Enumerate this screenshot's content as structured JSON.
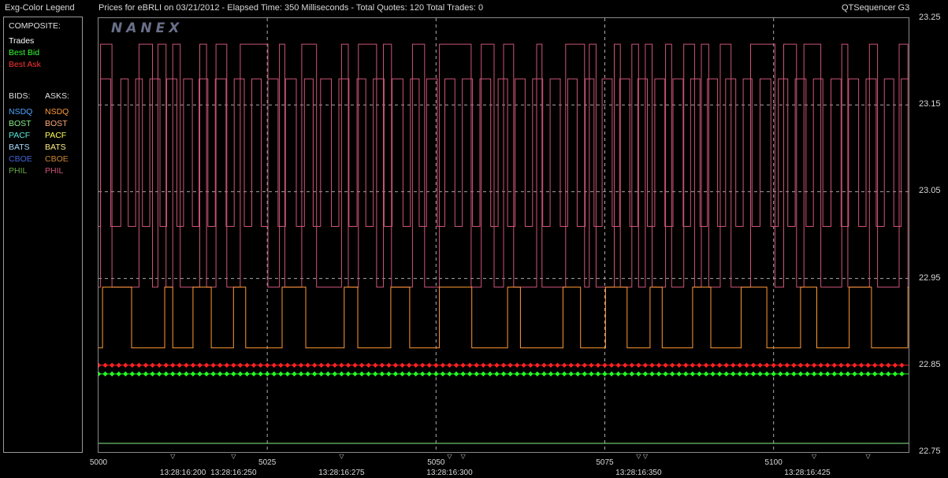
{
  "header": {
    "legend_title": "Exg-Color Legend",
    "prices_for": "Prices for  eBRLI  on  03/21/2012  -  Elapsed Time: 350 Milliseconds  -  Total Quotes: 120  Total Trades: 0",
    "app_name": "QTSequencer G3"
  },
  "legend": {
    "composite_label": "COMPOSITE:",
    "composite": [
      {
        "label": "Trades",
        "color": "#ffffff"
      },
      {
        "label": "Best Bid",
        "color": "#33ff33"
      },
      {
        "label": "Best Ask",
        "color": "#ff3333"
      }
    ],
    "bids_label": "BIDS:",
    "asks_label": "ASKS:",
    "bids": [
      {
        "label": "NSDQ",
        "color": "#4da6ff"
      },
      {
        "label": "BOST",
        "color": "#88ee88"
      },
      {
        "label": "PACF",
        "color": "#55eedd"
      },
      {
        "label": "BATS",
        "color": "#aaddff"
      },
      {
        "label": "CBOE",
        "color": "#4466dd"
      },
      {
        "label": "PHIL",
        "color": "#66aa44"
      }
    ],
    "asks": [
      {
        "label": "NSDQ",
        "color": "#ff9933"
      },
      {
        "label": "BOST",
        "color": "#ffaa77"
      },
      {
        "label": "PACF",
        "color": "#ffff55"
      },
      {
        "label": "BATS",
        "color": "#ffee88"
      },
      {
        "label": "CBOE",
        "color": "#cc8833"
      },
      {
        "label": "PHIL",
        "color": "#cc5577"
      }
    ]
  },
  "logo": "NANEX",
  "chart_data": {
    "type": "line",
    "title": "Prices for  eBRLI  on  03/21/2012",
    "ylim": [
      22.75,
      23.25
    ],
    "xlim": [
      5000,
      5120
    ],
    "y_ticks": [
      "23.25",
      "23.15",
      "23.05",
      "22.95",
      "22.85",
      "22.75"
    ],
    "y_gridlines": [
      23.15,
      23.05,
      22.95
    ],
    "x_ticks": [
      {
        "value": 5000,
        "label": "5000"
      },
      {
        "value": 5025,
        "label": "5025"
      },
      {
        "value": 5050,
        "label": "5050"
      },
      {
        "value": 5075,
        "label": "5075"
      },
      {
        "value": 5100,
        "label": "5100"
      }
    ],
    "time_labels": [
      {
        "value": 5012.5,
        "label": "13:28:16:200"
      },
      {
        "value": 5020,
        "label": "13:28:16:250"
      },
      {
        "value": 5036,
        "label": "13:28:16:275"
      },
      {
        "value": 5052,
        "label": "13:28:16:300"
      },
      {
        "value": 5080,
        "label": "13:28:16:350"
      },
      {
        "value": 5105,
        "label": "13:28:16:425"
      }
    ],
    "trade_markers": [
      5011,
      5020,
      5036,
      5052,
      5054,
      5080,
      5081,
      5106,
      5114
    ],
    "x_gridlines": [
      5025,
      5050,
      5075,
      5100
    ],
    "series": [
      {
        "name": "PHIL",
        "color": "#cc5577",
        "high": 23.22,
        "low": 22.94,
        "x": [
          5000,
          5000.3,
          5002,
          5006,
          5008,
          5008.8,
          5010,
          5011,
          5012.1,
          5015,
          5016,
          5017.4,
          5019,
          5021,
          5025.1,
          5026.8,
          5027.6,
          5030.1,
          5032.3,
          5036,
          5037,
          5038.5,
          5041.2,
          5042.2,
          5043.4,
          5046.5,
          5048.3,
          5050.5,
          5055.2,
          5056.7,
          5058.6,
          5060,
          5061.5,
          5064.9,
          5065.7,
          5069.2,
          5072,
          5072.7,
          5073.7,
          5076.4,
          5077.3,
          5079,
          5080,
          5081,
          5082,
          5084,
          5084.9,
          5086.7,
          5088.3,
          5089.3,
          5090.4,
          5092.1,
          5093.7,
          5096.6,
          5100.2,
          5101.5,
          5103.4,
          5104.5,
          5107,
          5110.1,
          5111,
          5114.2,
          5115.4,
          5118.6,
          5119.9
        ],
        "y": [
          22.94,
          23.22,
          22.94,
          23.22,
          22.94,
          23.22,
          22.94,
          23.22,
          22.94,
          23.22,
          22.94,
          23.22,
          22.94,
          23.22,
          22.94,
          23.22,
          22.94,
          23.22,
          22.94,
          23.22,
          22.94,
          23.22,
          22.94,
          23.22,
          22.94,
          23.22,
          22.94,
          23.22,
          22.94,
          23.22,
          22.94,
          23.22,
          22.94,
          23.22,
          22.94,
          23.22,
          22.94,
          23.22,
          22.94,
          23.22,
          22.94,
          23.22,
          22.94,
          23.22,
          22.94,
          23.22,
          22.94,
          23.22,
          22.94,
          23.22,
          22.94,
          23.22,
          22.94,
          23.22,
          22.94,
          23.22,
          22.94,
          23.22,
          22.94,
          23.22,
          22.94,
          23.22,
          22.94,
          23.22,
          22.94
        ]
      },
      {
        "name": "PHIL",
        "color": "#cc5577",
        "high": 23.18,
        "low": 23.01,
        "x": [
          5000,
          5000.3,
          5001.8,
          5003.3,
          5004.4,
          5005.5,
          5006.5,
          5007.6,
          5009.1,
          5010.1,
          5011.6,
          5012.6,
          5013.9,
          5014.9,
          5016.2,
          5017.3,
          5018.9,
          5020.1,
          5021.6,
          5022.7,
          5024.1,
          5025.1,
          5026.6,
          5027.7,
          5029.3,
          5030.5,
          5031.8,
          5032.9,
          5034.5,
          5035.6,
          5037.1,
          5038.3,
          5039.6,
          5040.7,
          5042.3,
          5043.5,
          5045.1,
          5046.2,
          5047.5,
          5048.6,
          5050.2,
          5051.3,
          5052.8,
          5053.9,
          5055.4,
          5056.5,
          5058.1,
          5059.2,
          5060.6,
          5061.7,
          5063.2,
          5064.3,
          5065.8,
          5066.9,
          5068.4,
          5069.5,
          5070.9,
          5072.1,
          5073.4,
          5074.6,
          5076.1,
          5077.2,
          5078.7,
          5079.9,
          5081.3,
          5082.4,
          5083.9,
          5085.1,
          5086.6,
          5087.7,
          5089.1,
          5090.2,
          5091.7,
          5092.9,
          5094.4,
          5095.5,
          5096.8,
          5098,
          5099.6,
          5100.7,
          5102.1,
          5103.2,
          5104.8,
          5105.9,
          5107.3,
          5108.5,
          5110,
          5111.1,
          5112.6,
          5113.7,
          5115.2,
          5116.4,
          5117.8,
          5118.9
        ],
        "y": [
          23.01,
          23.18,
          23.01,
          23.18,
          23.01,
          23.18,
          23.01,
          23.18,
          23.01,
          23.18,
          23.01,
          23.18,
          23.01,
          23.18,
          23.01,
          23.18,
          23.01,
          23.18,
          23.01,
          23.18,
          23.01,
          23.18,
          23.01,
          23.18,
          23.01,
          23.18,
          23.01,
          23.18,
          23.01,
          23.18,
          23.01,
          23.18,
          23.01,
          23.18,
          23.01,
          23.18,
          23.01,
          23.18,
          23.01,
          23.18,
          23.01,
          23.18,
          23.01,
          23.18,
          23.01,
          23.18,
          23.01,
          23.18,
          23.01,
          23.18,
          23.01,
          23.18,
          23.01,
          23.18,
          23.01,
          23.18,
          23.01,
          23.18,
          23.01,
          23.18,
          23.01,
          23.18,
          23.01,
          23.18,
          23.01,
          23.18,
          23.01,
          23.18,
          23.01,
          23.18,
          23.01,
          23.18,
          23.01,
          23.18,
          23.01,
          23.18,
          23.01,
          23.18,
          23.01,
          23.18,
          23.01,
          23.18,
          23.01,
          23.18,
          23.01,
          23.18,
          23.01,
          23.18,
          23.01,
          23.18,
          23.01,
          23.18,
          23.01,
          23.18
        ]
      },
      {
        "name": "NSDQ",
        "color": "#ff9933",
        "high": 22.94,
        "low": 22.87,
        "x": [
          5000,
          5000.6,
          5004.9,
          5009.8,
          5011,
          5014,
          5016.7,
          5020,
          5021.8,
          5027.2,
          5030.7,
          5036.4,
          5038.4,
          5043.3,
          5046.1,
          5050.5,
          5055.3,
          5060.6,
          5062.5,
          5068.8,
          5071.4,
          5075.1,
          5078.3,
          5081.7,
          5083.5,
          5088,
          5090.7,
          5095.2,
          5099,
          5104,
          5106.4,
          5111.2,
          5114.5,
          5119.9
        ],
        "y": [
          22.87,
          22.94,
          22.87,
          22.94,
          22.87,
          22.94,
          22.87,
          22.94,
          22.87,
          22.94,
          22.87,
          22.94,
          22.87,
          22.94,
          22.87,
          22.94,
          22.87,
          22.94,
          22.87,
          22.94,
          22.87,
          22.94,
          22.87,
          22.94,
          22.87,
          22.94,
          22.87,
          22.94,
          22.87,
          22.94,
          22.87,
          22.94,
          22.87,
          22.94
        ]
      },
      {
        "name": "Best Ask",
        "color": "#ff2222",
        "markers": true,
        "constant": 22.85
      },
      {
        "name": "Best Bid",
        "color": "#22ff22",
        "markers": true,
        "constant": 22.84
      },
      {
        "name": "BOST",
        "color": "#88ee88",
        "constant": 22.76
      }
    ]
  }
}
